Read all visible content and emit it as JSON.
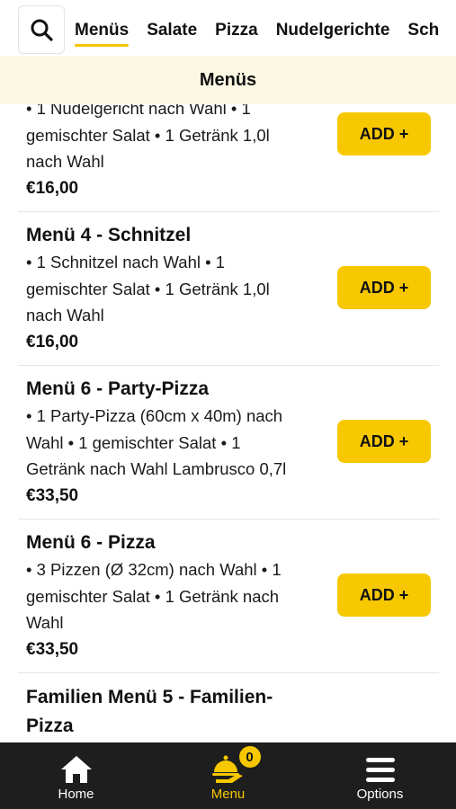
{
  "categories": [
    "Menüs",
    "Salate",
    "Pizza",
    "Nudelgerichte",
    "Sch"
  ],
  "section_title": "Menüs",
  "items": [
    {
      "title": "",
      "desc_lines": [
        "• 1 Nudelgericht nach Wahl • 1",
        "gemischter Salat • 1 Getränk 1,0l",
        "nach Wahl"
      ],
      "price": "€16,00",
      "add_label": "ADD +"
    },
    {
      "title": "Menü 4 - Schnitzel",
      "desc_lines": [
        "• 1 Schnitzel nach Wahl • 1",
        "gemischter Salat • 1 Getränk 1,0l",
        "nach Wahl"
      ],
      "price": "€16,00",
      "add_label": "ADD +"
    },
    {
      "title": "Menü 6 - Party-Pizza",
      "desc_lines": [
        "• 1 Party-Pizza (60cm x 40m) nach",
        "Wahl • 1 gemischter Salat • 1",
        "Getränk nach Wahl Lambrusco 0,7l"
      ],
      "price": "€33,50",
      "add_label": "ADD +"
    },
    {
      "title": "Menü 6 - Pizza",
      "desc_lines": [
        "• 3 Pizzen (Ø 32cm) nach Wahl • 1",
        "gemischter Salat • 1 Getränk nach",
        "Wahl"
      ],
      "price": "€33,50",
      "add_label": "ADD +"
    },
    {
      "title_lines": [
        "Familien Menü 5 - Familien-",
        "Pizza"
      ]
    }
  ],
  "nav": {
    "home_label": "Home",
    "menu_label": "Menu",
    "options_label": "Options",
    "cart_count": "0"
  },
  "colors": {
    "accent": "#f7c800",
    "header_bg": "#fcf8e3",
    "nav_bg": "#1e1e1e"
  },
  "icons": [
    "search-icon",
    "home-icon",
    "cloche-icon",
    "menu-icon"
  ]
}
